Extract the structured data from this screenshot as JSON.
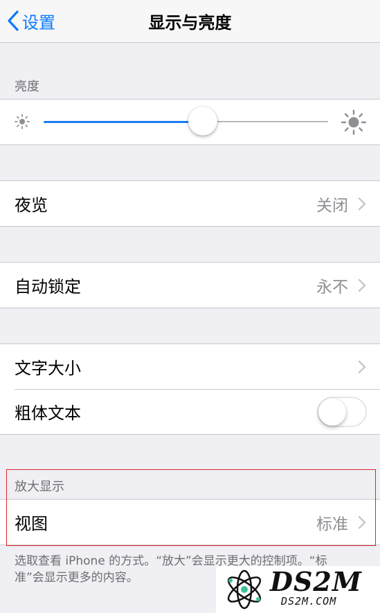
{
  "nav": {
    "back_label": "设置",
    "title": "显示与亮度"
  },
  "brightness": {
    "section_label": "亮度",
    "level": 0.56
  },
  "night_shift": {
    "label": "夜览",
    "value": "关闭"
  },
  "auto_lock": {
    "label": "自动锁定",
    "value": "永不"
  },
  "text": {
    "size_label": "文字大小",
    "bold_label": "粗体文本",
    "bold_on": false
  },
  "zoom": {
    "section_label": "放大显示",
    "view_label": "视图",
    "view_value": "标准",
    "footnote": "选取查看 iPhone 的方式。“放大”会显示更大的控制项。“标准”会显示更多的内容。"
  },
  "watermark": {
    "big": "DS2M",
    "small": "DS2M.COM"
  },
  "colors": {
    "accent": "#0a7aff",
    "slider_fill": "#1a7cf5",
    "highlight": "#d9252a"
  }
}
